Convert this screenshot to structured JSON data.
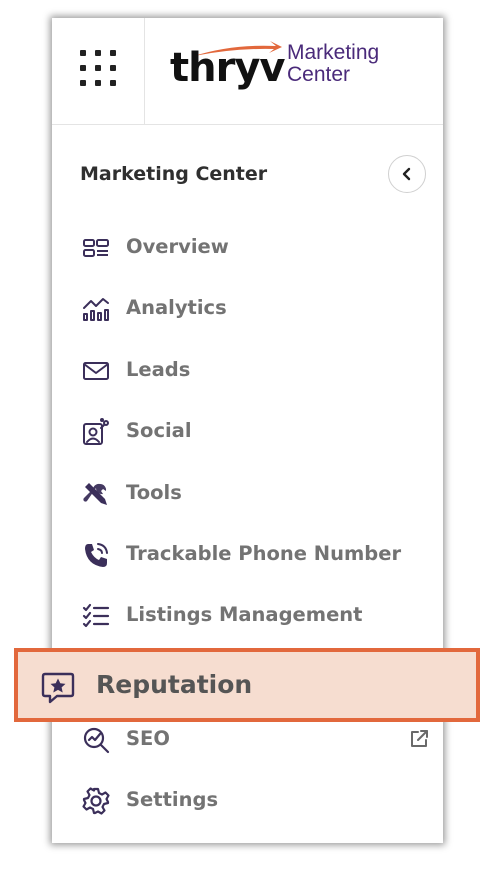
{
  "brand": {
    "wordmark": "thryv",
    "product_line1": "Marketing",
    "product_line2": "Center",
    "wordmark_color": "#111111",
    "swoosh_color": "#e2683c",
    "product_color": "#4a2a7a"
  },
  "sidebar": {
    "title": "Marketing Center",
    "items": [
      {
        "label": "Overview",
        "icon": "overview-icon"
      },
      {
        "label": "Analytics",
        "icon": "analytics-icon"
      },
      {
        "label": "Leads",
        "icon": "mail-icon"
      },
      {
        "label": "Social",
        "icon": "social-icon"
      },
      {
        "label": "Tools",
        "icon": "tools-icon"
      },
      {
        "label": "Trackable Phone Number",
        "icon": "phone-icon"
      },
      {
        "label": "Listings Management",
        "icon": "checklist-icon"
      },
      {
        "label": "Reputation",
        "icon": "star-message-icon",
        "highlighted": true
      },
      {
        "label": "SEO",
        "icon": "seo-icon",
        "external": true
      },
      {
        "label": "Settings",
        "icon": "gear-icon"
      }
    ]
  },
  "colors": {
    "icon": "#3b2f5a",
    "label": "#737373",
    "highlight_border": "#e2683c",
    "highlight_fill": "#f6ddd0"
  }
}
